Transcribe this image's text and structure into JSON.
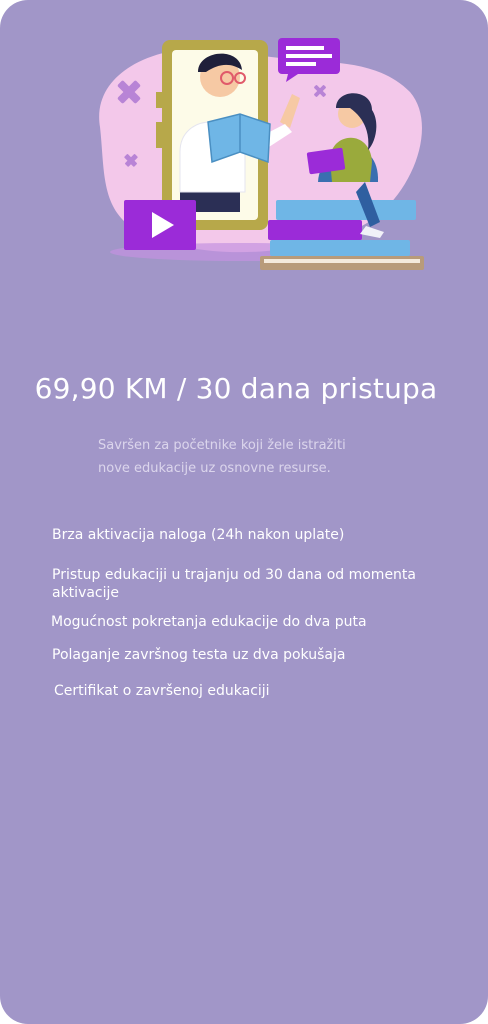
{
  "plan": {
    "price_text": "69,90 KM / 30 dana pristupa",
    "subtitle_line1": "Savršen za početnike koji žele istražiti",
    "subtitle_line2": "nove edukacije uz osnovne resurse.",
    "features": [
      "Brza aktivacija naloga (24h nakon uplate)",
      "Pristup edukaciji u trajanju od 30 dana od momenta aktivacije",
      "Mogućnost pokretanja edukacije do dva puta",
      "Polaganje završnog testa uz dva pokušaja",
      "Certifikat o završenoj edukaciji"
    ]
  },
  "colors": {
    "card_background": "#a196c8",
    "accent_purple": "#9b2bd8",
    "blob_pink": "#f3c8ea",
    "phone_frame": "#b7a84a"
  }
}
